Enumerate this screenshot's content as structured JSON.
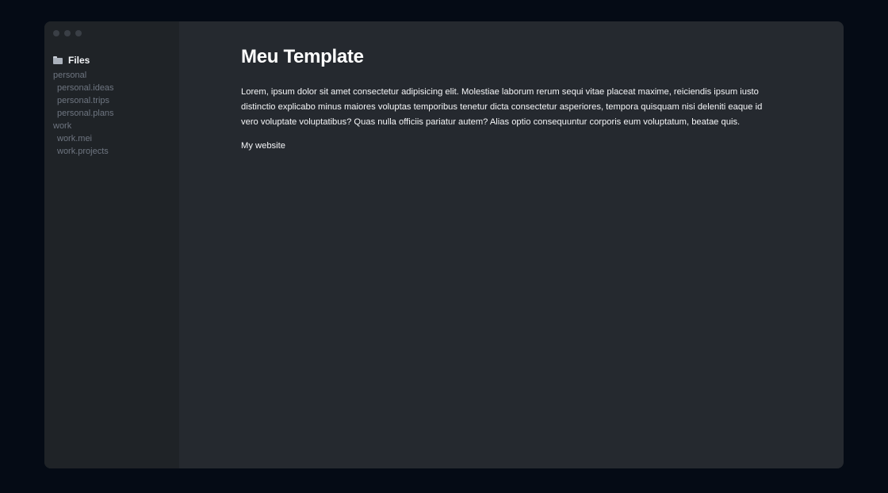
{
  "sidebar": {
    "header": "Files",
    "items": [
      {
        "label": "personal",
        "child": false
      },
      {
        "label": "personal.ideas",
        "child": true
      },
      {
        "label": "personal.trips",
        "child": true
      },
      {
        "label": "personal.plans",
        "child": true
      },
      {
        "label": "work",
        "child": false
      },
      {
        "label": "work.mei",
        "child": true
      },
      {
        "label": "work.projects",
        "child": true
      }
    ]
  },
  "main": {
    "title": "Meu Template",
    "body": "Lorem, ipsum dolor sit amet consectetur adipisicing elit. Molestiae laborum rerum sequi vitae placeat maxime, reiciendis ipsum iusto distinctio explicabo minus maiores voluptas temporibus tenetur dicta consectetur asperiores, tempora quisquam nisi deleniti eaque id vero voluptate voluptatibus? Quas nulla officiis pariatur autem? Alias optio consequuntur corporis eum voluptatum, beatae quis.",
    "link_label": "My website"
  },
  "colors": {
    "page_background": "#050b15",
    "sidebar_background": "#1f2327",
    "content_background": "#25292f",
    "tree_text": "#6e7580",
    "title_text": "#ffffff"
  },
  "icons": {
    "files": "folder-icon"
  }
}
